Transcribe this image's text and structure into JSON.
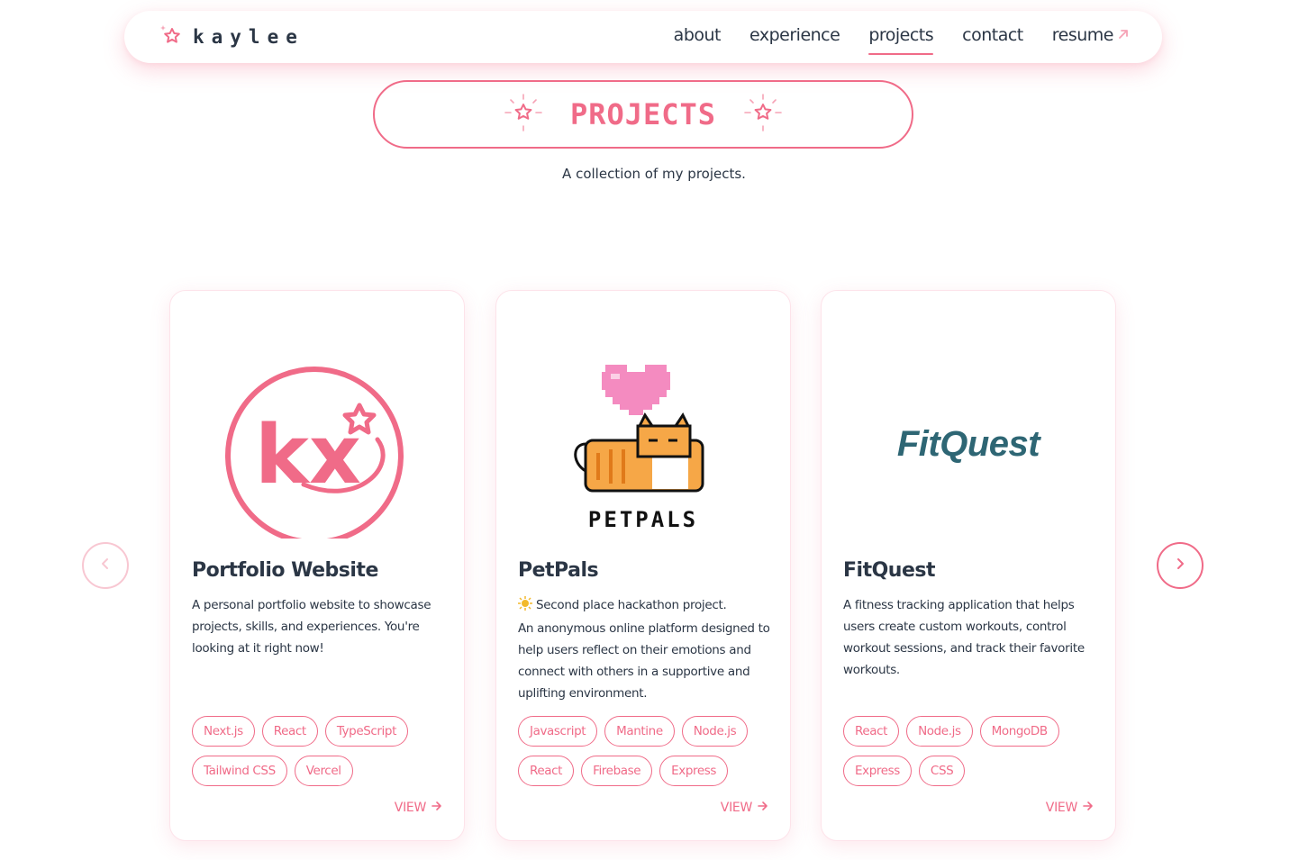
{
  "nav": {
    "brand": "kaylee",
    "links": [
      {
        "label": "about"
      },
      {
        "label": "experience"
      },
      {
        "label": "projects"
      },
      {
        "label": "contact"
      },
      {
        "label": "resume"
      }
    ]
  },
  "header": {
    "title": "PROJECTS",
    "subtitle": "A collection of my projects."
  },
  "cards": [
    {
      "title": "Portfolio Website",
      "logo_text": "kx",
      "description_lines": [
        "A personal portfolio website to showcase",
        "projects, skills, and experiences. You're",
        "looking at it right now!"
      ],
      "tags": [
        "Next.js",
        "React",
        "TypeScript",
        "Tailwind CSS",
        "Vercel"
      ],
      "view": "VIEW"
    },
    {
      "title": "PetPals",
      "logo_text": "PETPALS",
      "description_lines": [
        "Second place hackathon project.",
        "An anonymous online platform designed to",
        "help users reflect on their emotions and",
        "connect with others in a supportive and",
        "uplifting environment."
      ],
      "tags": [
        "Javascript",
        "Mantine",
        "Node.js",
        "React",
        "Firebase",
        "Express"
      ],
      "view": "VIEW"
    },
    {
      "title": "FitQuest",
      "logo_text": "FitQuest",
      "description_lines": [
        "A fitness tracking application that helps",
        "users create custom workouts, control",
        "workout sessions, and track their favorite",
        "workouts."
      ],
      "tags": [
        "React",
        "Node.js",
        "MongoDB",
        "Express",
        "CSS"
      ],
      "view": "VIEW"
    }
  ],
  "colors": {
    "accent": "#f06b88",
    "text": "#2b3645",
    "fitquest": "#2e6674"
  },
  "icons": [
    "star-logo-icon",
    "sparkle-star-icon",
    "arrow-up-right-icon",
    "chevron-left-icon",
    "chevron-right-icon",
    "arrow-right-icon"
  ]
}
